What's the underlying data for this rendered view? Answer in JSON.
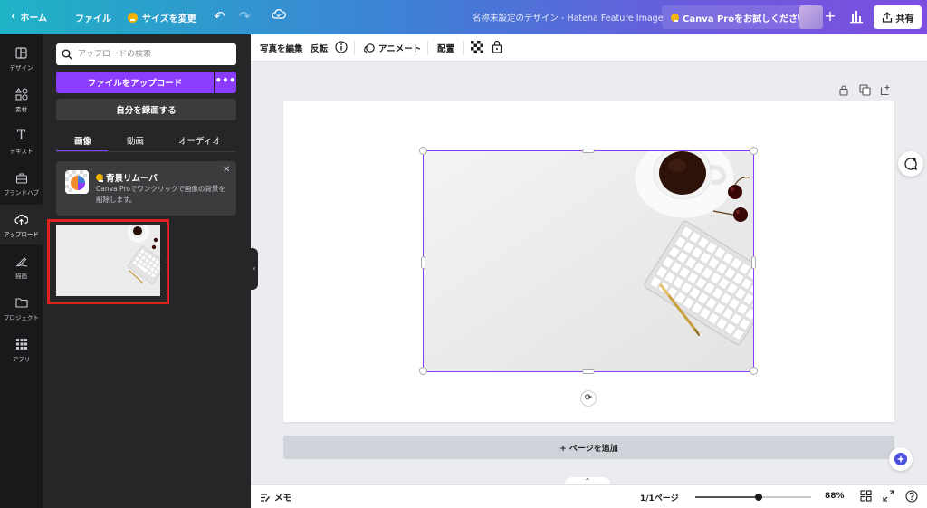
{
  "topbar": {
    "home_label": "ホーム",
    "file_label": "ファイル",
    "resize_label": "サイズを変更",
    "design_title": "名称未設定のデザイン - Hatena Feature Image",
    "pro_button": "Canva Proをお試しください",
    "share_label": "共有",
    "gradient_colors": [
      "#1fb3c6",
      "#3f7fd6",
      "#6b5bdc",
      "#7c4fe0"
    ]
  },
  "rail": {
    "items": [
      {
        "label": "デザイン",
        "icon": "layout-icon"
      },
      {
        "label": "素材",
        "icon": "shapes-icon"
      },
      {
        "label": "テキスト",
        "icon": "text-icon"
      },
      {
        "label": "ブランドハブ",
        "icon": "brand-icon"
      },
      {
        "label": "アップロード",
        "icon": "cloud-upload-icon"
      },
      {
        "label": "描画",
        "icon": "draw-icon"
      },
      {
        "label": "プロジェクト",
        "icon": "folder-icon"
      },
      {
        "label": "アプリ",
        "icon": "apps-icon"
      }
    ]
  },
  "panel": {
    "search_placeholder": "アップロードの検索",
    "upload_button": "ファイルをアップロード",
    "more_label": "•••",
    "record_button": "自分を録画する",
    "tabs": [
      "画像",
      "動画",
      "オーディオ"
    ],
    "active_tab": "画像",
    "promo": {
      "title": "背景リムーバ",
      "text": "Canva Proでワンクリックで画像の背景を削除します。"
    },
    "accent_color": "#8b3dff",
    "highlight_color": "#e0201d"
  },
  "toolbar": {
    "edit_photo": "写真を編集",
    "flip": "反転",
    "animate": "アニメート",
    "position": "配置"
  },
  "canvas": {
    "add_page": "+ ページを追加"
  },
  "bottombar": {
    "notes": "メモ",
    "pages": "1/1ページ",
    "zoom": "88%",
    "zoom_fraction": 0.55
  }
}
